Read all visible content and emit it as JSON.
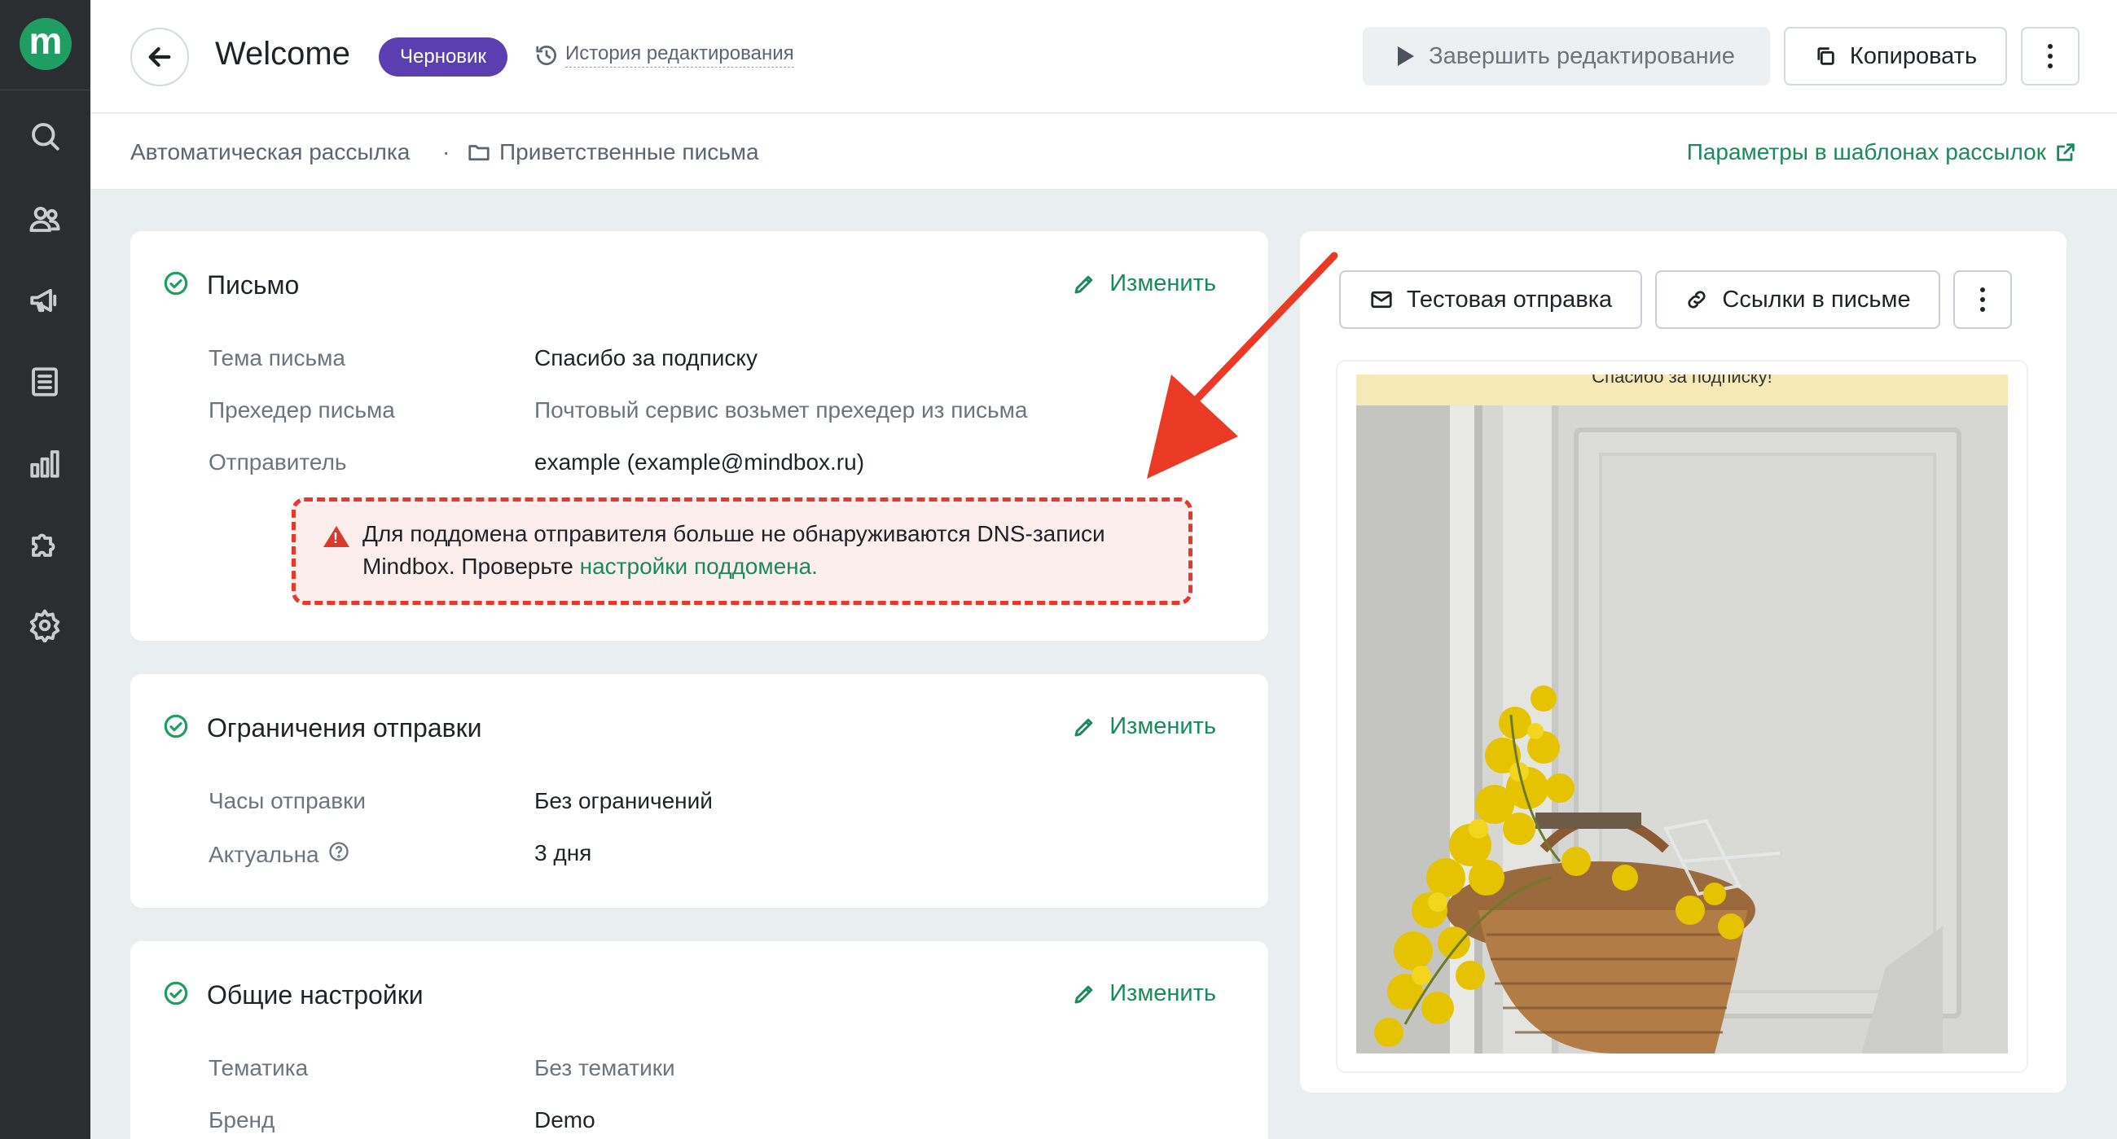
{
  "app": {
    "logo_letter": "m"
  },
  "sidebar": {
    "items": [
      {
        "name": "search-icon"
      },
      {
        "name": "users-icon"
      },
      {
        "name": "megaphone-icon"
      },
      {
        "name": "document-icon"
      },
      {
        "name": "chart-icon"
      },
      {
        "name": "puzzle-icon"
      },
      {
        "name": "gear-icon"
      }
    ]
  },
  "header": {
    "title": "Welcome",
    "status_badge": "Черновик",
    "history_label": "История редактирования",
    "finish_label": "Завершить редактирование",
    "copy_label": "Копировать"
  },
  "breadcrumb": {
    "root": "Автоматическая рассылка",
    "separator": "·",
    "folder": "Приветственные письма",
    "params_link": "Параметры в шаблонах рассылок"
  },
  "letter_card": {
    "title": "Письмо",
    "edit_label": "Изменить",
    "rows": [
      {
        "label": "Тема письма",
        "value": "Спасибо за подписку"
      },
      {
        "label": "Прехедер письма",
        "value": "Почтовый сервис возьмет прехедер из письма"
      },
      {
        "label": "Отправитель",
        "value": "example (example@mindbox.ru)"
      }
    ],
    "warning": {
      "text": "Для поддомена отправителя больше не обнаруживаются DNS-записи Mindbox. Проверьте ",
      "link": "настройки поддомена."
    }
  },
  "limits_card": {
    "title": "Ограничения отправки",
    "edit_label": "Изменить",
    "rows": [
      {
        "label": "Часы отправки",
        "value": "Без ограничений"
      },
      {
        "label": "Актуальна",
        "value": "3 дня"
      }
    ]
  },
  "general_card": {
    "title": "Общие настройки",
    "edit_label": "Изменить",
    "rows": [
      {
        "label": "Тематика",
        "value": "Без тематики"
      },
      {
        "label": "Бренд",
        "value": "Demo"
      }
    ]
  },
  "preview": {
    "test_send_label": "Тестовая отправка",
    "links_label": "Ссылки в письме",
    "email_header_text": "Спасибо за подписку!"
  },
  "colors": {
    "accent_green": "#1b8a5a",
    "badge_purple": "#5b3fb0",
    "warning_red": "#e5392c",
    "sidebar_bg": "#2b2e30"
  }
}
